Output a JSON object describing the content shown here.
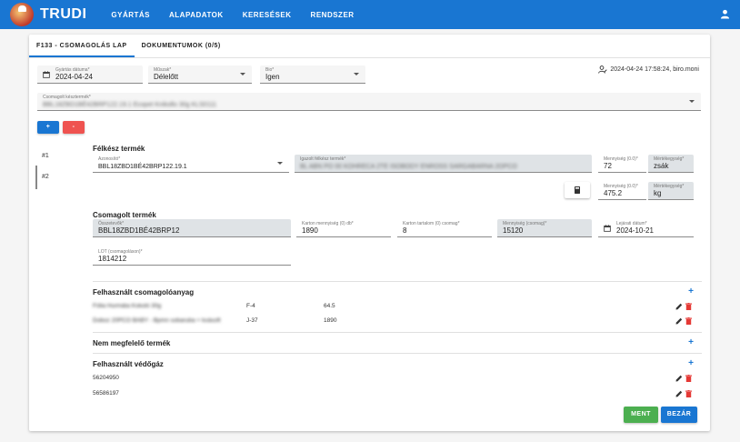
{
  "app": {
    "brand": "TRUDI"
  },
  "nav": [
    "GYÁRTÁS",
    "ALAPADATOK",
    "KERESÉSEK",
    "RENDSZER"
  ],
  "tabs": [
    "F133 - CSOMAGOLÁS LAP",
    "DOKUMENTUMOK (0/5)"
  ],
  "header_fields": {
    "date": {
      "label": "Gyártás dátuma*",
      "value": "2024-04-24"
    },
    "shift": {
      "label": "Műszak*",
      "value": "Délelőtt"
    },
    "bio": {
      "label": "Bio*",
      "value": "Igen"
    },
    "meta": "2024-04-24 17:58:24, biro.moni"
  },
  "product": {
    "label": "Csomagolt késztermék*",
    "value": "BBL18ZBD1BÉ42BRP122.19.1 Ecopet Knikollo 30g KLS0111"
  },
  "buttons": {
    "add": "+",
    "remove": "-",
    "save": "MENT",
    "close": "BEZÁR"
  },
  "side": [
    "#1",
    "#2"
  ],
  "semi": {
    "title": "Félkész termék",
    "id_label": "Azonosító*",
    "id_value": "BBL18ZBD1BÉ42BRP122.19.1",
    "spec_label": "Igazolt félkész termék*",
    "spec_value": "BL ABN PO 00 KOHRECA 2TE ISOBODY ENROSS SARGABARNA 2OPCO",
    "qty1_label": "Mennyiség (0.0)*",
    "qty1_value": "72",
    "unit1_label": "Mértékegység*",
    "unit1_value": "zsák",
    "qty2_label": "Mennyiség (0.0)*",
    "qty2_value": "475.2",
    "unit2_label": "Mértékegység*",
    "unit2_value": "kg"
  },
  "packed": {
    "title": "Csomagolt termék",
    "pack_label": "Összetevők*",
    "pack_value": "BBL18ZBD1BÉ42BRP12",
    "carton_qty_label": "Karton mennyiség (0) db*",
    "carton_qty_value": "1890",
    "carton_content_label": "Karton tartalom (0) csomag*",
    "carton_content_value": "8",
    "pkg_qty_label": "Mennyiség (csomag)*",
    "pkg_qty_value": "15120",
    "expiry_label": "Lejárati dátum*",
    "expiry_value": "2024-10-21",
    "lot_label": "LOT (csomagoláson)*",
    "lot_value": "1814212"
  },
  "materials": {
    "title": "Felhasznált csomagolóanyag",
    "rows": [
      {
        "name": "Fólia Hurmáta Kokoló 30g",
        "code": "F-4",
        "qty": "64.5"
      },
      {
        "name": "Doboz 20PCO BABY - Bpmn sobaruba + kvásoft",
        "code": "J-37",
        "qty": "1890"
      }
    ]
  },
  "nonconform": {
    "title": "Nem megfelelő termék"
  },
  "gas": {
    "title": "Felhasznált védőgáz",
    "rows": [
      "56204950",
      "56586197"
    ]
  },
  "colors": {
    "primary": "#1976d2",
    "danger": "#e53935",
    "success": "#4caf50"
  }
}
